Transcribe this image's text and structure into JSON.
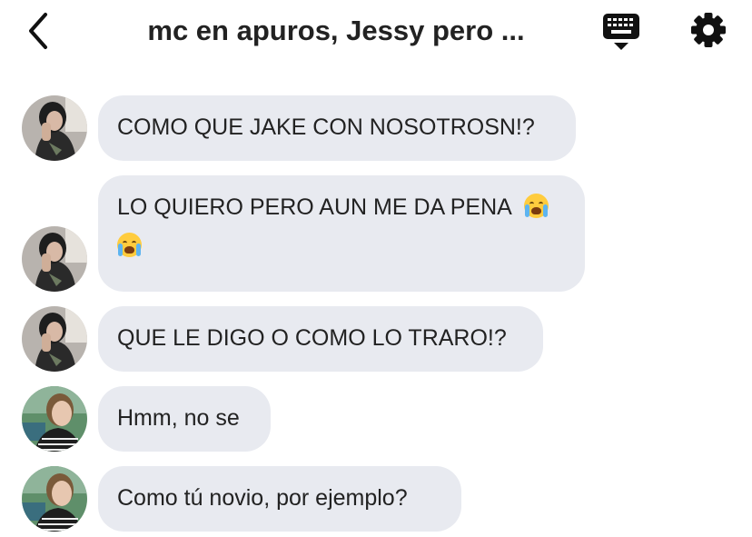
{
  "header": {
    "title": "mc en apuros, Jessy pero ...",
    "back_icon": "chevron-left-icon",
    "keyboard_icon": "keyboard-icon",
    "settings_icon": "gear-icon"
  },
  "colors": {
    "bubble": "#e8eaf0",
    "text": "#222222",
    "icon": "#111111"
  },
  "messages": [
    {
      "sender": "user-a",
      "text": "COMO QUE JAKE CON NOSOTROSN!?"
    },
    {
      "sender": "user-a",
      "text": "LO QUIERO PERO AUN ME DA PENA",
      "emojis": [
        "loudly-crying-face",
        "loudly-crying-face"
      ]
    },
    {
      "sender": "user-a",
      "text": "QUE LE DIGO O COMO LO TRARO!?"
    },
    {
      "sender": "user-b",
      "text": "Hmm, no se"
    },
    {
      "sender": "user-b",
      "text": "Como tú novio, por ejemplo?"
    }
  ]
}
